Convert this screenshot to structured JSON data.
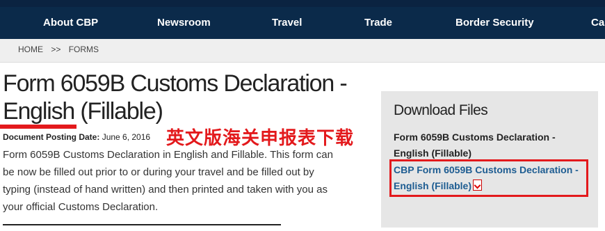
{
  "nav": {
    "items": [
      "About CBP",
      "Newsroom",
      "Travel",
      "Trade",
      "Border Security",
      "Car"
    ]
  },
  "breadcrumb": {
    "home": "HOME",
    "separator": ">>",
    "current": "FORMS"
  },
  "page": {
    "title": "Form 6059B Customs Declaration - English (Fillable)",
    "annotation": "英文版海关申报表下载",
    "posting_label": "Document Posting Date:",
    "posting_date": "June 6, 2016",
    "body": "Form 6059B Customs Declaration in English and Fillable.  This form can be now be filled out prior to or during your travel and be filled out by typing (instead of hand written) and then printed and taken with you as your official Customs Declaration."
  },
  "download": {
    "heading": "Download Files",
    "file_title": "Form 6059B Customs Declaration - English (Fillable)",
    "file_link": "CBP Form 6059B Customs Declaration - English (Fillable)",
    "file_icon": "pdf-icon"
  },
  "colors": {
    "nav_bg": "#0b2a4a",
    "accent_red": "#e3191c",
    "link_blue": "#1d5c91"
  }
}
